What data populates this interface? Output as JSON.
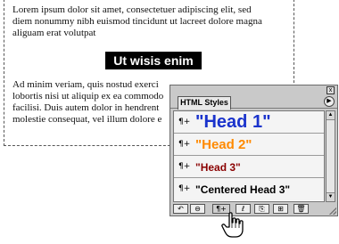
{
  "document": {
    "lines": [
      "Lorem ipsum dolor sit amet, consectetuer adipiscing elit, sed",
      "diem nonummy nibh euismod tincidunt ut lacreet dolore magna",
      "aliguam erat volutpat",
      "Ad minim veriam, quis nostud exerci",
      "lobortis nisi ut aliquip ex ea commodo",
      "facilisi. Duis autem dolor in hendrent",
      "molestie consequat, vel illum dolore e"
    ],
    "heading": "Ut wisis enim"
  },
  "palette": {
    "tab_label": "HTML Styles",
    "close_glyph": "x",
    "menu_glyph": "▶",
    "styles": [
      {
        "mark": "¶+",
        "label": "\"Head 1\"",
        "color": "#1a33cc"
      },
      {
        "mark": "¶+",
        "label": "\"Head 2\"",
        "color": "#ff8a00"
      },
      {
        "mark": "¶+",
        "label": "\"Head 3\"",
        "color": "#8a0000"
      },
      {
        "mark": "¶+",
        "label": "\"Centered Head 3\"",
        "color": "#000000"
      }
    ],
    "scroll_up_glyph": "▲",
    "scroll_down_glyph": "▼",
    "toolbar_buttons": [
      "↶",
      "⊖",
      "¶+",
      "ℓ",
      "⎘",
      "⊞",
      "🗑"
    ]
  }
}
